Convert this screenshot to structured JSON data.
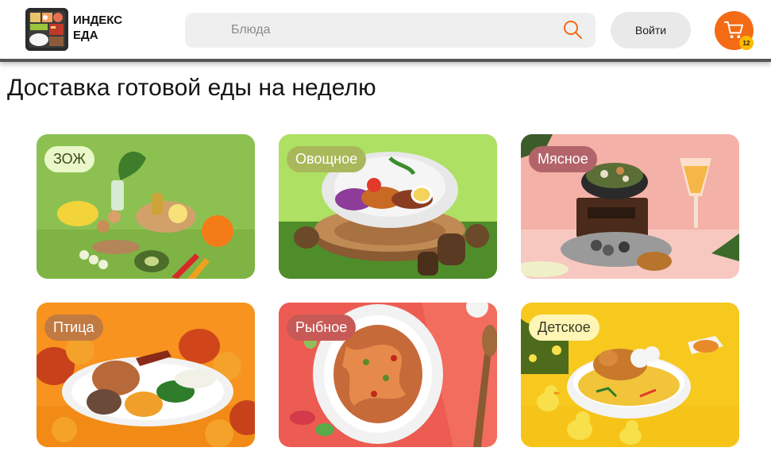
{
  "brand": {
    "line1": "ИНДЕКС",
    "line2": "ЕДА"
  },
  "search": {
    "placeholder": "Блюда",
    "value": ""
  },
  "header": {
    "login_label": "Войти",
    "cart_count": "12"
  },
  "page": {
    "title": "Доставка готовой еды на неделю"
  },
  "categories": [
    {
      "label": "ЗОЖ"
    },
    {
      "label": "Овощное"
    },
    {
      "label": "Мясное"
    },
    {
      "label": "Птица"
    },
    {
      "label": "Рыбное"
    },
    {
      "label": "Детское"
    }
  ],
  "colors": {
    "accent": "#f36b14",
    "badge": "#ffb800"
  }
}
